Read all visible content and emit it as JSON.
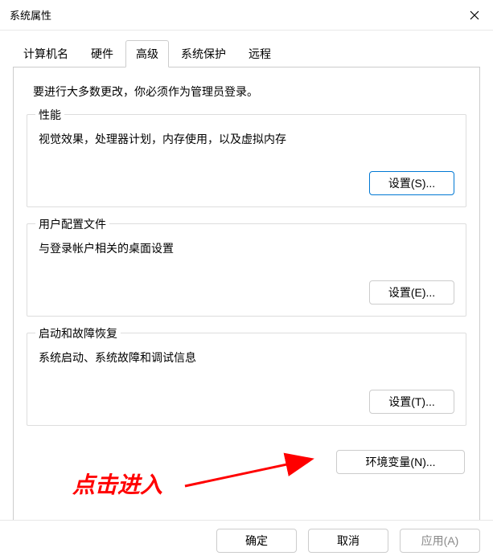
{
  "window": {
    "title": "系统属性"
  },
  "tabs": {
    "computer_name": "计算机名",
    "hardware": "硬件",
    "advanced": "高级",
    "system_protection": "系统保护",
    "remote": "远程"
  },
  "content": {
    "intro": "要进行大多数更改，你必须作为管理员登录。",
    "performance": {
      "title": "性能",
      "desc": "视觉效果，处理器计划，内存使用，以及虚拟内存",
      "button": "设置(S)..."
    },
    "userprofile": {
      "title": "用户配置文件",
      "desc": "与登录帐户相关的桌面设置",
      "button": "设置(E)..."
    },
    "startup": {
      "title": "启动和故障恢复",
      "desc": "系统启动、系统故障和调试信息",
      "button": "设置(T)..."
    },
    "env_button": "环境变量(N)..."
  },
  "footer": {
    "ok": "确定",
    "cancel": "取消",
    "apply": "应用(A)"
  },
  "annotation": {
    "text": "点击进入"
  }
}
